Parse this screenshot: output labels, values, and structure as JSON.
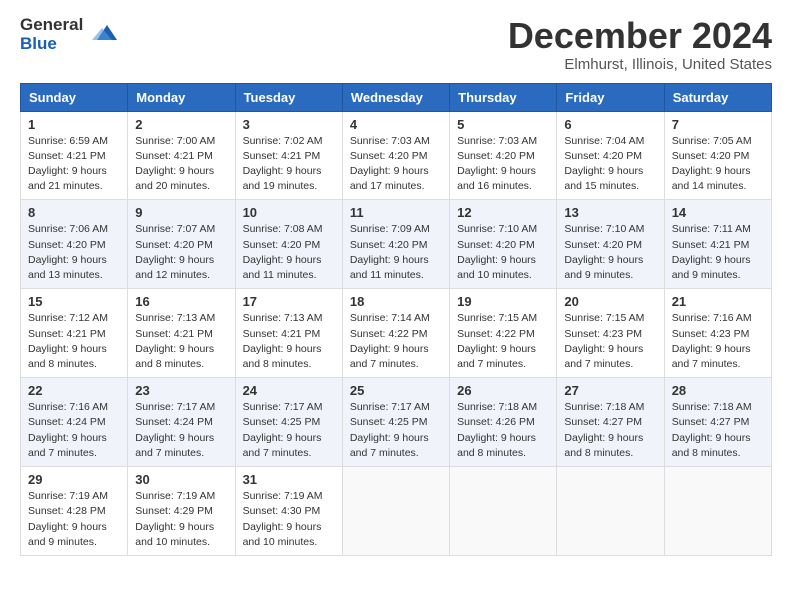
{
  "header": {
    "logo_line1": "General",
    "logo_line2": "Blue",
    "month": "December 2024",
    "location": "Elmhurst, Illinois, United States"
  },
  "days_of_week": [
    "Sunday",
    "Monday",
    "Tuesday",
    "Wednesday",
    "Thursday",
    "Friday",
    "Saturday"
  ],
  "weeks": [
    [
      {
        "day": "1",
        "sunrise": "6:59 AM",
        "sunset": "4:21 PM",
        "daylight": "9 hours and 21 minutes."
      },
      {
        "day": "2",
        "sunrise": "7:00 AM",
        "sunset": "4:21 PM",
        "daylight": "9 hours and 20 minutes."
      },
      {
        "day": "3",
        "sunrise": "7:02 AM",
        "sunset": "4:21 PM",
        "daylight": "9 hours and 19 minutes."
      },
      {
        "day": "4",
        "sunrise": "7:03 AM",
        "sunset": "4:20 PM",
        "daylight": "9 hours and 17 minutes."
      },
      {
        "day": "5",
        "sunrise": "7:03 AM",
        "sunset": "4:20 PM",
        "daylight": "9 hours and 16 minutes."
      },
      {
        "day": "6",
        "sunrise": "7:04 AM",
        "sunset": "4:20 PM",
        "daylight": "9 hours and 15 minutes."
      },
      {
        "day": "7",
        "sunrise": "7:05 AM",
        "sunset": "4:20 PM",
        "daylight": "9 hours and 14 minutes."
      }
    ],
    [
      {
        "day": "8",
        "sunrise": "7:06 AM",
        "sunset": "4:20 PM",
        "daylight": "9 hours and 13 minutes."
      },
      {
        "day": "9",
        "sunrise": "7:07 AM",
        "sunset": "4:20 PM",
        "daylight": "9 hours and 12 minutes."
      },
      {
        "day": "10",
        "sunrise": "7:08 AM",
        "sunset": "4:20 PM",
        "daylight": "9 hours and 11 minutes."
      },
      {
        "day": "11",
        "sunrise": "7:09 AM",
        "sunset": "4:20 PM",
        "daylight": "9 hours and 11 minutes."
      },
      {
        "day": "12",
        "sunrise": "7:10 AM",
        "sunset": "4:20 PM",
        "daylight": "9 hours and 10 minutes."
      },
      {
        "day": "13",
        "sunrise": "7:10 AM",
        "sunset": "4:20 PM",
        "daylight": "9 hours and 9 minutes."
      },
      {
        "day": "14",
        "sunrise": "7:11 AM",
        "sunset": "4:21 PM",
        "daylight": "9 hours and 9 minutes."
      }
    ],
    [
      {
        "day": "15",
        "sunrise": "7:12 AM",
        "sunset": "4:21 PM",
        "daylight": "9 hours and 8 minutes."
      },
      {
        "day": "16",
        "sunrise": "7:13 AM",
        "sunset": "4:21 PM",
        "daylight": "9 hours and 8 minutes."
      },
      {
        "day": "17",
        "sunrise": "7:13 AM",
        "sunset": "4:21 PM",
        "daylight": "9 hours and 8 minutes."
      },
      {
        "day": "18",
        "sunrise": "7:14 AM",
        "sunset": "4:22 PM",
        "daylight": "9 hours and 7 minutes."
      },
      {
        "day": "19",
        "sunrise": "7:15 AM",
        "sunset": "4:22 PM",
        "daylight": "9 hours and 7 minutes."
      },
      {
        "day": "20",
        "sunrise": "7:15 AM",
        "sunset": "4:23 PM",
        "daylight": "9 hours and 7 minutes."
      },
      {
        "day": "21",
        "sunrise": "7:16 AM",
        "sunset": "4:23 PM",
        "daylight": "9 hours and 7 minutes."
      }
    ],
    [
      {
        "day": "22",
        "sunrise": "7:16 AM",
        "sunset": "4:24 PM",
        "daylight": "9 hours and 7 minutes."
      },
      {
        "day": "23",
        "sunrise": "7:17 AM",
        "sunset": "4:24 PM",
        "daylight": "9 hours and 7 minutes."
      },
      {
        "day": "24",
        "sunrise": "7:17 AM",
        "sunset": "4:25 PM",
        "daylight": "9 hours and 7 minutes."
      },
      {
        "day": "25",
        "sunrise": "7:17 AM",
        "sunset": "4:25 PM",
        "daylight": "9 hours and 7 minutes."
      },
      {
        "day": "26",
        "sunrise": "7:18 AM",
        "sunset": "4:26 PM",
        "daylight": "9 hours and 8 minutes."
      },
      {
        "day": "27",
        "sunrise": "7:18 AM",
        "sunset": "4:27 PM",
        "daylight": "9 hours and 8 minutes."
      },
      {
        "day": "28",
        "sunrise": "7:18 AM",
        "sunset": "4:27 PM",
        "daylight": "9 hours and 8 minutes."
      }
    ],
    [
      {
        "day": "29",
        "sunrise": "7:19 AM",
        "sunset": "4:28 PM",
        "daylight": "9 hours and 9 minutes."
      },
      {
        "day": "30",
        "sunrise": "7:19 AM",
        "sunset": "4:29 PM",
        "daylight": "9 hours and 10 minutes."
      },
      {
        "day": "31",
        "sunrise": "7:19 AM",
        "sunset": "4:30 PM",
        "daylight": "9 hours and 10 minutes."
      },
      null,
      null,
      null,
      null
    ]
  ],
  "colors": {
    "header_bg": "#2a6bbf",
    "row_even": "#f0f4fa",
    "row_odd": "#ffffff"
  }
}
